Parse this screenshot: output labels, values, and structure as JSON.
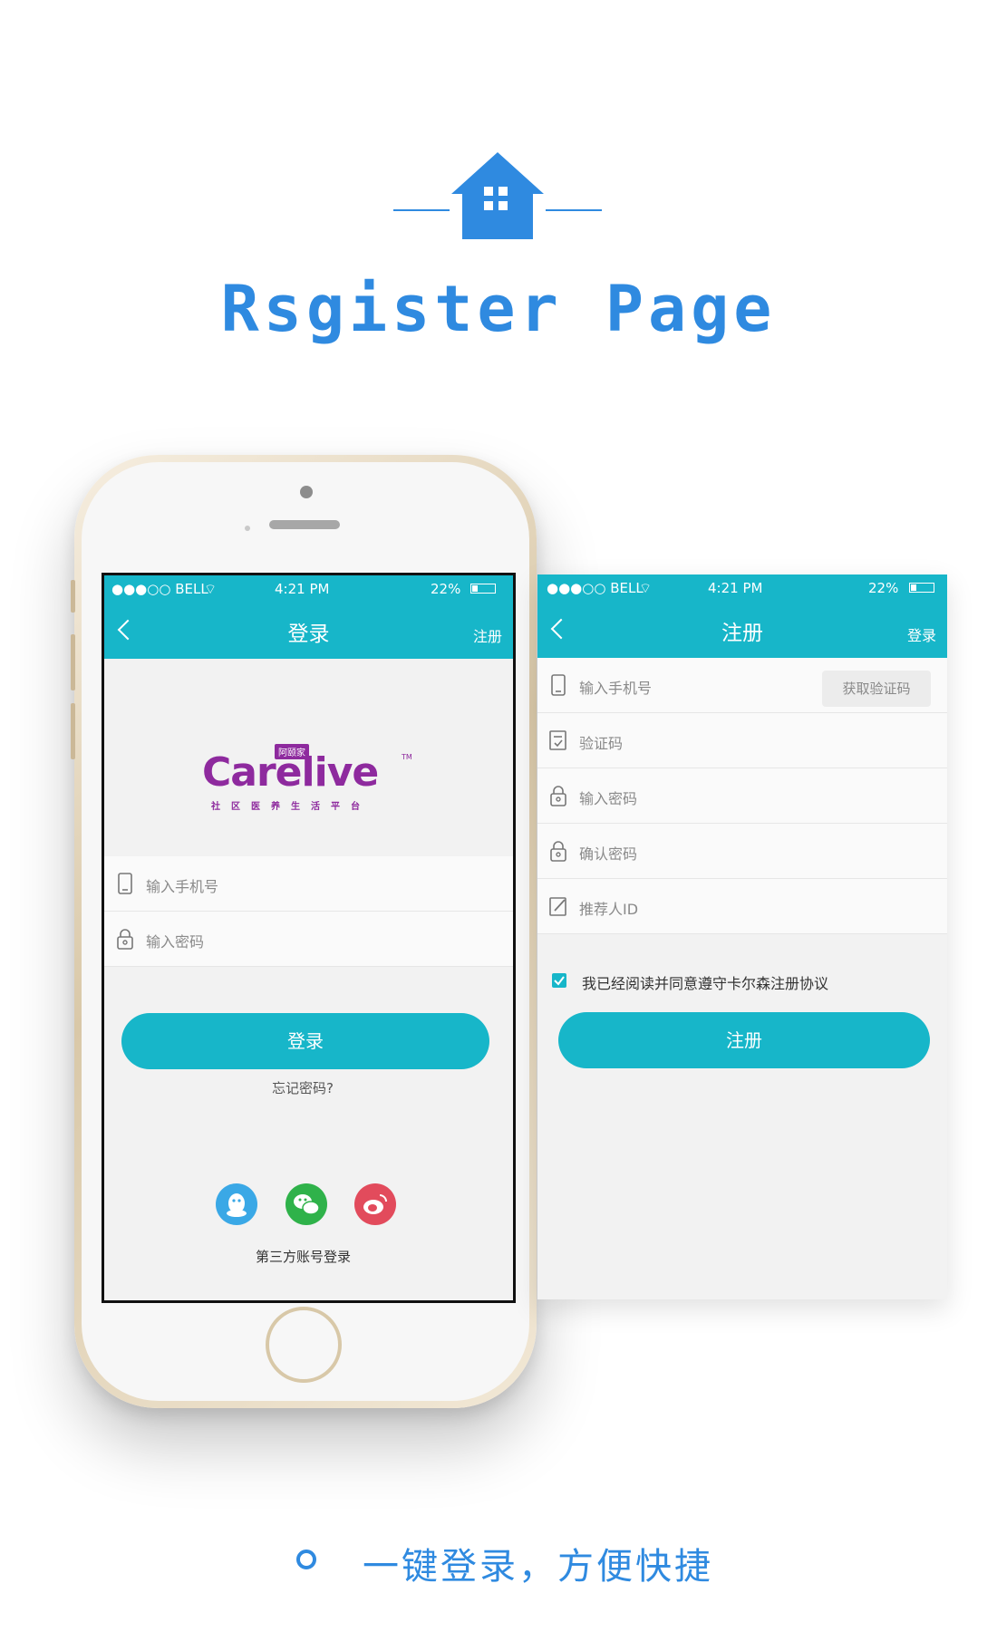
{
  "header": {
    "title": "Rsgister Page",
    "accent_color": "#2f8ae0",
    "icon": "house-icon"
  },
  "status_bar": {
    "carrier": "●●●○○ BELL",
    "time": "4:21 PM",
    "battery": "22%"
  },
  "login_screen": {
    "nav_title": "登录",
    "nav_right": "注册",
    "logo": {
      "wordmark": "Carelive",
      "tag": "阿颐家",
      "tm": "TM",
      "tagline": "社区医养生活平台"
    },
    "phone_placeholder": "输入手机号",
    "password_placeholder": "输入密码",
    "login_button": "登录",
    "forgot_password": "忘记密码?",
    "third_party_label": "第三方账号登录",
    "social_icons": [
      "qq-icon",
      "wechat-icon",
      "weibo-icon"
    ]
  },
  "register_screen": {
    "nav_title": "注册",
    "nav_right": "登录",
    "phone_placeholder": "输入手机号",
    "get_code_button": "获取验证码",
    "code_placeholder": "验证码",
    "password_placeholder": "输入密码",
    "confirm_placeholder": "确认密码",
    "referrer_placeholder": "推荐人ID",
    "agreement": "我已经阅读并同意遵守卡尔森注册协议",
    "agreement_checked": true,
    "register_button": "注册"
  },
  "footer": {
    "text": "一键登录，方便快捷"
  },
  "colors": {
    "theme_teal": "#17b6c9",
    "logo_purple": "#8e2a9e",
    "qq_blue": "#3aa8e6",
    "wechat_green": "#2fb24a",
    "weibo_red": "#e24b5c"
  }
}
